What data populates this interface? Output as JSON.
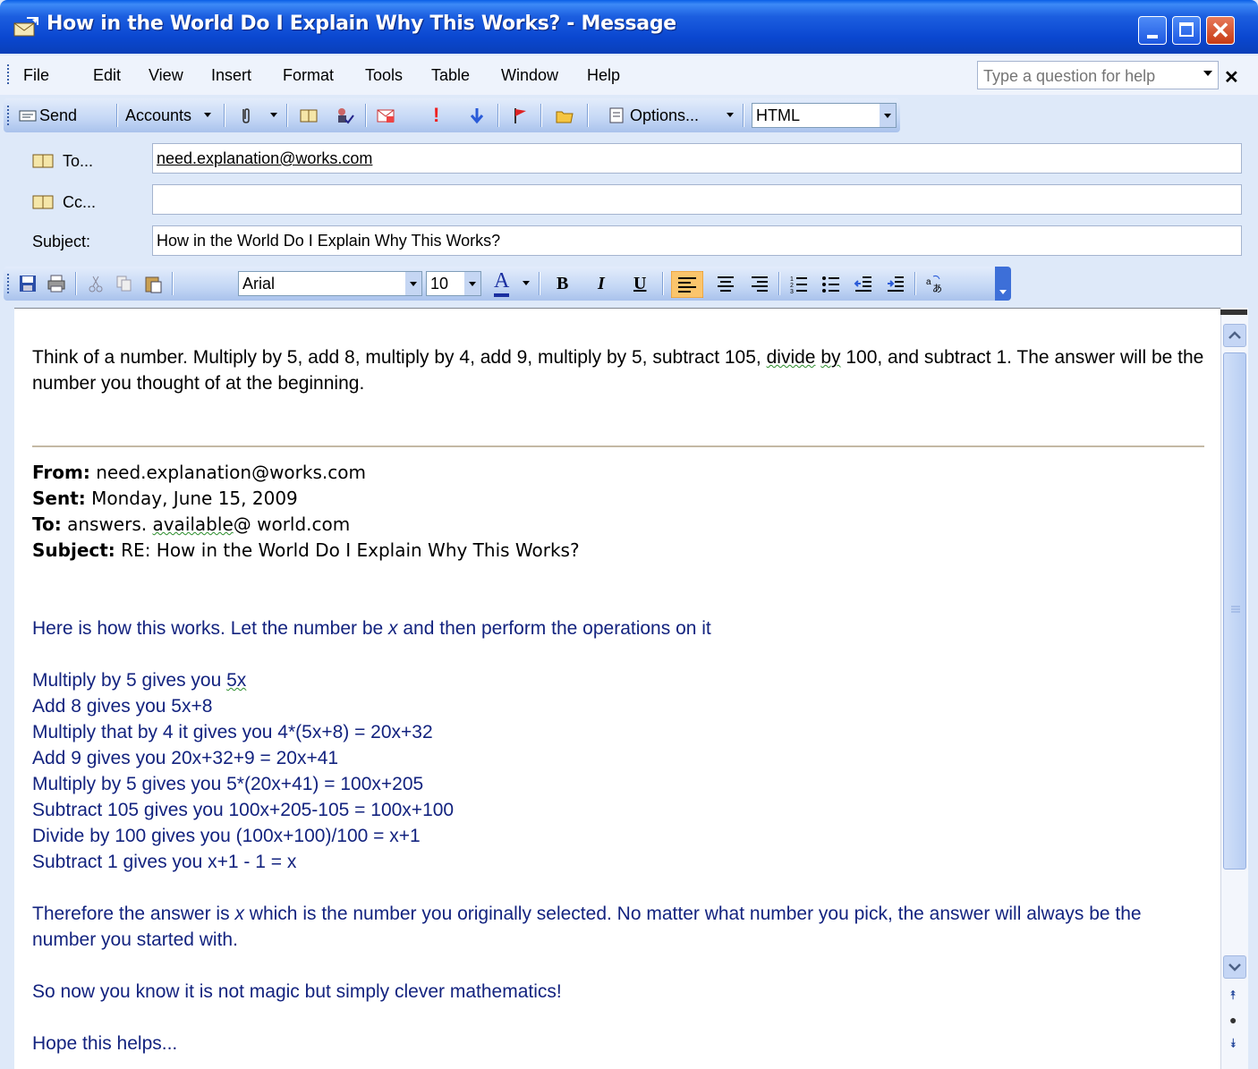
{
  "window": {
    "title": "How in the World Do I Explain Why This Works? - Message"
  },
  "menu": {
    "items": [
      "File",
      "Edit",
      "View",
      "Insert",
      "Format",
      "Tools",
      "Table",
      "Window",
      "Help"
    ],
    "help_placeholder": "Type a question for help"
  },
  "toolbar": {
    "send_label": "Send",
    "accounts_label": "Accounts",
    "options_label": "Options...",
    "format_value": "HTML"
  },
  "header": {
    "to_label": "To...",
    "to_value": "need.explanation@works.com",
    "cc_label": "Cc...",
    "cc_value": "",
    "subject_label": "Subject:",
    "subject_value": "How in the World Do I Explain Why This Works?"
  },
  "format_toolbar": {
    "font": "Arial",
    "size": "10"
  },
  "message": {
    "question_pre": "Think of a number. Multiply by 5, add 8, multiply by 4, add 9, multiply by 5, subtract 105,",
    "question_divide": "divide",
    "question_by": "by",
    "question_post": "100, and subtract 1. The answer will be the number you thought of at the beginning.",
    "from_label": "From:",
    "from_value": "need.explanation@works.com",
    "sent_label": "Sent:",
    "sent_value": "Monday, June 15, 2009",
    "to_label": "To:",
    "to_value_pre": "answers.",
    "to_value_mid": "available",
    "to_value_post": "@ world.com",
    "subject_label": "Subject:",
    "subject_value": "RE: How in the World Do I Explain Why This Works?",
    "intro_pre": "Here is how this works. Let the number be",
    "intro_var": "x",
    "intro_post": "and then perform the operations on it",
    "step1_pre": "Multiply by 5 gives you",
    "step1_squig": "5x",
    "steps": [
      "Add 8 gives you 5x+8",
      "Multiply that by 4 it gives you 4*(5x+8) = 20x+32",
      "Add 9 gives you 20x+32+9 = 20x+41",
      "Multiply by 5 gives you 5*(20x+41) = 100x+205",
      "Subtract 105 gives you 100x+205-105 = 100x+100",
      "Divide by 100 gives you (100x+100)/100 = x+1",
      "Subtract 1 gives you x+1 - 1 = x"
    ],
    "therefore_pre": "Therefore the answer is",
    "therefore_var": "x",
    "therefore_post": "which is the number you originally selected. No matter what number you pick, the answer will always be the number you started with.",
    "magic": "So now you know it is not magic but simply clever mathematics!",
    "closing": "Hope this helps..."
  }
}
